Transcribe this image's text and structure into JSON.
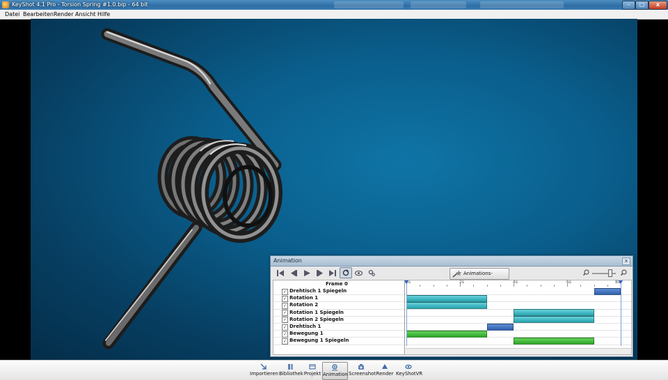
{
  "window": {
    "title": "KeyShot 4.1 Pro - Torsion Spring #1.0.bip - 64 bit",
    "controls": {
      "minimize": "–",
      "maximize": "□",
      "close": "x"
    }
  },
  "menu": [
    "Datei",
    "Bearbeiten",
    "Render",
    "Ansicht",
    "Hilfe"
  ],
  "animation_panel": {
    "title": "Animation",
    "close": "x",
    "assistant_label": "Animations-Assistent",
    "frame_label": "Frame 0",
    "ruler_labels": [
      "0s",
      "2s",
      "4s",
      "6s",
      "8s"
    ],
    "zoom_level": 0.72,
    "tracks": [
      {
        "label": "Drehtisch 1 Spiegeln",
        "checked": true,
        "start": 7.0,
        "end": 8.0,
        "color": "#3a69b7"
      },
      {
        "label": "Rotation 1",
        "checked": true,
        "start": 0.0,
        "end": 3.0,
        "color": "#2eaab5"
      },
      {
        "label": "Rotation 2",
        "checked": true,
        "start": 0.0,
        "end": 3.0,
        "color": "#2eaab5"
      },
      {
        "label": "Rotation 1 Spiegeln",
        "checked": true,
        "start": 4.0,
        "end": 7.0,
        "color": "#2eaab5"
      },
      {
        "label": "Rotation 2 Spiegeln",
        "checked": true,
        "start": 4.0,
        "end": 7.0,
        "color": "#2eaab5"
      },
      {
        "label": "Drehtisch 1",
        "checked": true,
        "start": 3.0,
        "end": 4.0,
        "color": "#3a69b7"
      },
      {
        "label": "Bewegung 1",
        "checked": true,
        "start": 0.0,
        "end": 3.0,
        "color": "#36b02f"
      },
      {
        "label": "Bewegung 1 Spiegeln",
        "checked": true,
        "start": 4.0,
        "end": 7.0,
        "color": "#36b02f"
      }
    ]
  },
  "bottom_toolbar": [
    {
      "label": "Importieren",
      "icon": "import-icon"
    },
    {
      "label": "Bibliothek",
      "icon": "library-icon"
    },
    {
      "label": "Projekt",
      "icon": "project-icon"
    },
    {
      "label": "Animation",
      "icon": "animation-icon",
      "active": true
    },
    {
      "label": "Screenshot",
      "icon": "screenshot-icon"
    },
    {
      "label": "Render",
      "icon": "render-icon"
    },
    {
      "label": "KeyShotVR",
      "icon": "keyshotvr-icon"
    }
  ],
  "colors": {
    "viewport_bg": "#0a5e8c",
    "titlebar": "#3a7bb3",
    "spring": "#2c2c2c"
  }
}
